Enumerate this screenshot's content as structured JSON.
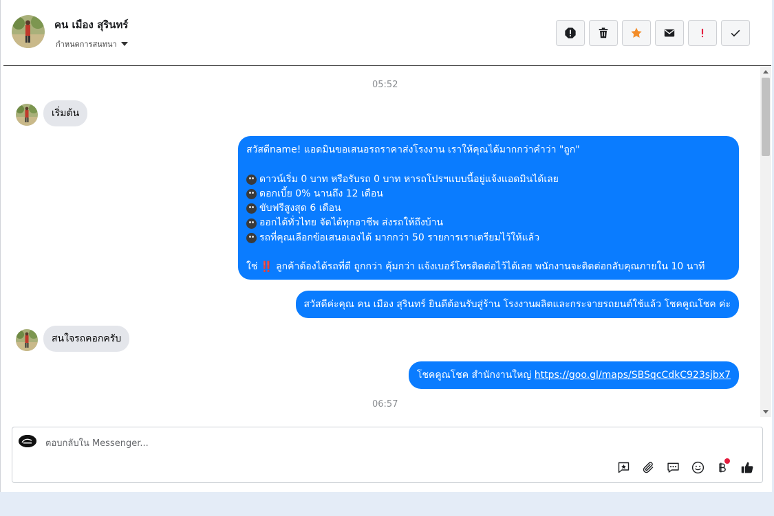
{
  "header": {
    "contact_name": "คน เมือง สุรินทร์",
    "conversation_settings": "กำหนดการสนทนา",
    "toolbar": [
      {
        "name": "report-icon",
        "label": "Report"
      },
      {
        "name": "trash-icon",
        "label": "Delete"
      },
      {
        "name": "star-icon",
        "label": "Star",
        "color": "#f28c28"
      },
      {
        "name": "envelope-icon",
        "label": "Mark unread"
      },
      {
        "name": "exclamation-icon",
        "label": "Spam",
        "color": "#e41e3f"
      },
      {
        "name": "checkmark-icon",
        "label": "Done"
      }
    ]
  },
  "chat": {
    "timestamps": [
      "05:52",
      "06:57"
    ],
    "messages": {
      "m1": "เริ่มต้น",
      "big": {
        "line0": "สวัสดีname! แอดมินขอเสนอรถราคาส่งโรงงาน เราให้คุณได้มากกว่าคำว่า \"ถูก\"",
        "line1": "ดาวน์เริ่ม 0 บาท หรือรับรถ 0 บาท หารถโปรฯแบบนี้อยู่แจ้งแอดมินได้เลย",
        "line2": "ดอกเบี้ย 0% นานถึง 12 เดือน",
        "line3": "ขับฟรีสูงสุด 6 เดือน",
        "line4": "ออกได้ทั่วไทย จัดได้ทุกอาชีพ ส่งรถให้ถึงบ้าน",
        "line5": "รถที่คุณเลือกข้อเสนอเองได้ มากกว่า 50 รายการเราเตรียมไว้ให้แล้ว",
        "line6_prefix": "ใช่",
        "line6_mark": "‼️",
        "line6": "ลูกค้าต้องได้รถที่ดี ถูกกว่า คุ้มกว่า แจ้งเบอร์โทรติดต่อไว้ได้เลย พนักงานจะติดต่อกลับคุณภายใน 10 นาที"
      },
      "m3": "สวัสดีค่ะคุณ คน เมือง สุรินทร์ ยินดีต้อนรับสู่ร้าน โรงงานผลิตและกระจายรถยนต์ใช้แล้ว โชคคูณโชค ค่ะ",
      "m4": "สนใจรถคอกครับ",
      "m5_text": "โชคคูณโชค สำนักงานใหญ่",
      "m5_link": "https://goo.gl/maps/SBSqcCdkC923sjbx7"
    }
  },
  "composer": {
    "placeholder": "ตอบกลับใน Messenger...",
    "tools": [
      "saved-reply-icon",
      "attachment-icon",
      "quick-reply-icon",
      "emoji-icon",
      "baht-payment-icon",
      "thumbs-up-icon"
    ]
  },
  "colors": {
    "outgoing_bubble": "#0a7cff",
    "incoming_bubble": "#e4e6eb",
    "star": "#f28c28",
    "spam": "#e41e3f"
  }
}
